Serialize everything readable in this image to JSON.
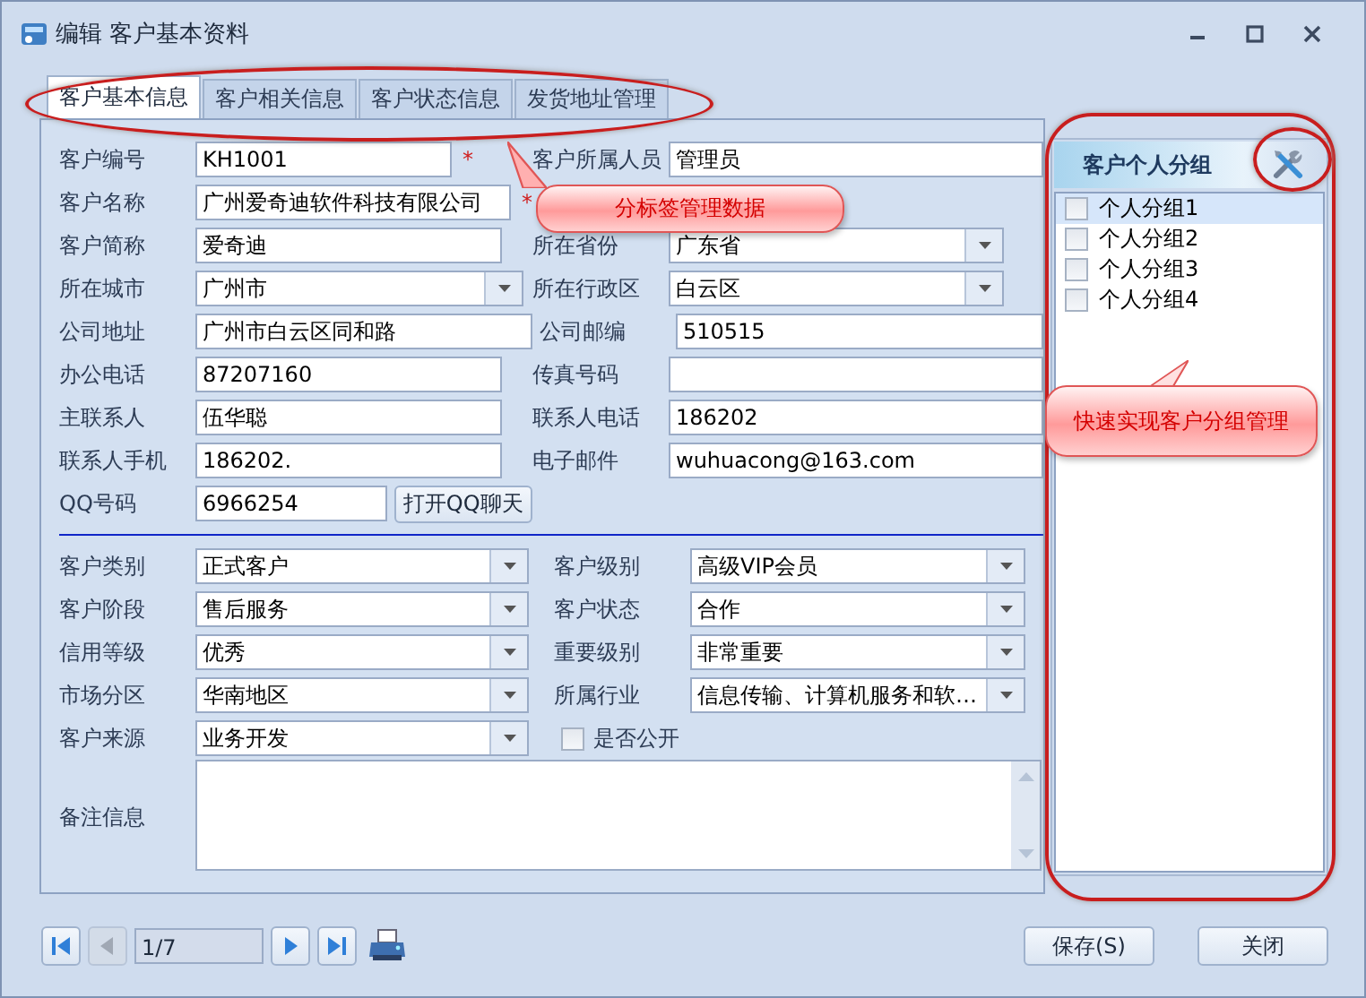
{
  "window": {
    "title": "编辑 客户基本资料"
  },
  "tabs": [
    {
      "label": "客户基本信息",
      "selected": true
    },
    {
      "label": "客户相关信息",
      "selected": false
    },
    {
      "label": "客户状态信息",
      "selected": false
    },
    {
      "label": "发货地址管理",
      "selected": false
    }
  ],
  "form": {
    "rows": [
      {
        "kind": "pair",
        "fields": [
          {
            "label": "客户编号",
            "kind": "text",
            "value": "KH1001",
            "mark": "*"
          },
          {
            "label": "客户所属人员",
            "kind": "text",
            "value": "管理员"
          }
        ]
      },
      {
        "kind": "full",
        "fields": [
          {
            "label": "客户名称",
            "kind": "text",
            "value": "广州爱奇迪软件科技有限公司",
            "mark": "*"
          }
        ]
      },
      {
        "kind": "pair",
        "fields": [
          {
            "label": "客户简称",
            "kind": "text",
            "value": "爱奇迪"
          },
          {
            "label": "所在省份",
            "kind": "combo",
            "value": "广东省"
          }
        ]
      },
      {
        "kind": "pair",
        "fields": [
          {
            "label": "所在城市",
            "kind": "combo",
            "value": "广州市"
          },
          {
            "label": "所在行政区",
            "kind": "combo",
            "value": "白云区"
          }
        ]
      },
      {
        "kind": "address",
        "fields": [
          {
            "label": "公司地址",
            "kind": "text",
            "value": "广州市白云区同和路"
          },
          {
            "label": "公司邮编",
            "kind": "text",
            "value": "510515"
          }
        ]
      },
      {
        "kind": "pair",
        "fields": [
          {
            "label": "办公电话",
            "kind": "text",
            "value": "87207160"
          },
          {
            "label": "传真号码",
            "kind": "text"
          }
        ]
      },
      {
        "kind": "pair",
        "fields": [
          {
            "label": "主联系人",
            "kind": "text",
            "value": "伍华聪"
          },
          {
            "label": "联系人电话",
            "kind": "text",
            "value": "186202"
          }
        ]
      },
      {
        "kind": "pair",
        "fields": [
          {
            "label": "联系人手机",
            "kind": "text",
            "value": "186202."
          },
          {
            "label": "电子邮件",
            "kind": "text",
            "value": "wuhuacong@163.com"
          }
        ]
      },
      {
        "kind": "qq",
        "fields": [
          {
            "label": "QQ号码",
            "kind": "text",
            "value": "6966254"
          }
        ],
        "button": "打开QQ聊天"
      }
    ]
  },
  "details": {
    "rows": [
      {
        "fields": [
          {
            "label": "客户类别",
            "kind": "combo",
            "value": "正式客户"
          },
          {
            "label": "客户级别",
            "kind": "combo",
            "value": "高级VIP会员"
          }
        ]
      },
      {
        "fields": [
          {
            "label": "客户阶段",
            "kind": "combo",
            "value": "售后服务"
          },
          {
            "label": "客户状态",
            "kind": "combo",
            "value": "合作"
          }
        ]
      },
      {
        "fields": [
          {
            "label": "信用等级",
            "kind": "combo",
            "value": "优秀"
          },
          {
            "label": "重要级别",
            "kind": "combo",
            "value": "非常重要"
          }
        ]
      },
      {
        "fields": [
          {
            "label": "市场分区",
            "kind": "combo",
            "value": "华南地区"
          },
          {
            "label": "所属行业",
            "kind": "combo",
            "value": "信息传输、计算机服务和软…"
          }
        ]
      },
      {
        "fields": [
          {
            "label": "客户来源",
            "kind": "combo",
            "value": "业务开发"
          },
          {
            "label": "是否公开",
            "kind": "checkbox",
            "checked": false
          }
        ]
      }
    ],
    "notes": {
      "label": "备注信息"
    }
  },
  "group_panel": {
    "title": "客户个人分组",
    "items": [
      {
        "label": "个人分组1",
        "checked": false,
        "selected": true
      },
      {
        "label": "个人分组2",
        "checked": false,
        "selected": false
      },
      {
        "label": "个人分组3",
        "checked": false,
        "selected": false
      },
      {
        "label": "个人分组4",
        "checked": false,
        "selected": false
      }
    ]
  },
  "pager": {
    "items": [
      {
        "kind": "first",
        "disabled": false
      },
      {
        "kind": "prev",
        "disabled": true
      },
      {
        "kind": "page",
        "text": "1/7"
      },
      {
        "kind": "next",
        "disabled": false
      },
      {
        "kind": "last",
        "disabled": false
      },
      {
        "kind": "print"
      }
    ]
  },
  "buttons": [
    "保存(S)",
    "关闭"
  ],
  "callouts": [
    {
      "text": "分标签管理数据"
    },
    {
      "text": "快速实现客户分组管理"
    }
  ]
}
